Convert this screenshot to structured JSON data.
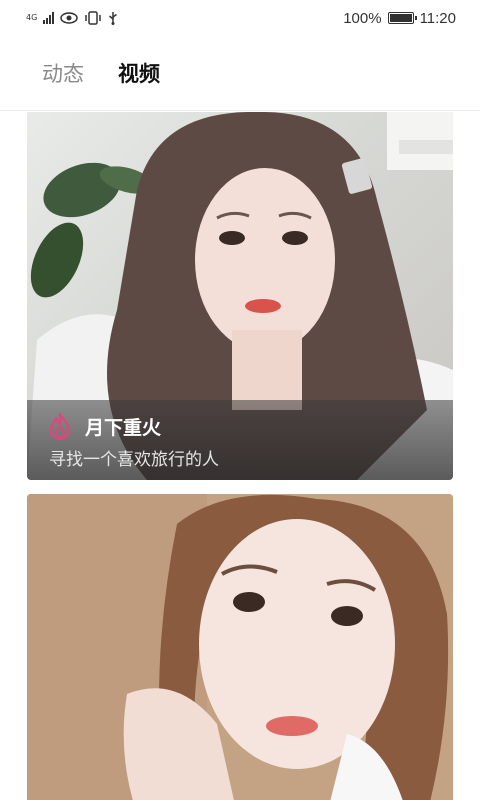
{
  "status_bar": {
    "network_type": "4G",
    "battery_percent": "100%",
    "battery_level": 1.0,
    "time": "11:20",
    "icons": [
      "signal-icon",
      "eye-icon",
      "vibrate-icon",
      "usb-icon",
      "battery-icon"
    ]
  },
  "tabs": [
    {
      "label": "动态",
      "active": false
    },
    {
      "label": "视频",
      "active": true
    }
  ],
  "feed": {
    "cards": [
      {
        "name": "月下重火",
        "description": "寻找一个喜欢旅行的人",
        "badge_icon": "fire-icon",
        "accent": "#e0457b"
      },
      {
        "name": "",
        "description": ""
      }
    ]
  }
}
